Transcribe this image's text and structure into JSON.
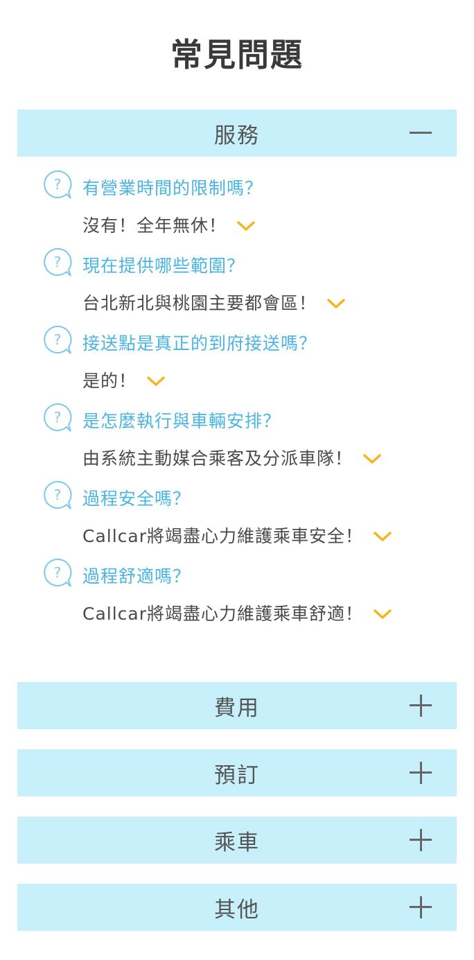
{
  "page": {
    "title": "常見問題"
  },
  "categories": [
    {
      "label": "服務",
      "toggle_icon": "minus-icon",
      "expanded": true,
      "items": [
        {
          "question": "有營業時間的限制嗎？",
          "answer": "沒有！全年無休！"
        },
        {
          "question": "現在提供哪些範圍？",
          "answer": "台北新北與桃園主要都會區！"
        },
        {
          "question": "接送點是真正的到府接送嗎？",
          "answer": "是的！"
        },
        {
          "question": "是怎麼執行與車輛安排？",
          "answer": "由系統主動媒合乘客及分派車隊！"
        },
        {
          "question": "過程安全嗎？",
          "answer": "Callcar將竭盡心力維護乘車安全！"
        },
        {
          "question": "過程舒適嗎？",
          "answer": "Callcar將竭盡心力維護乘車舒適！"
        }
      ]
    },
    {
      "label": "費用",
      "toggle_icon": "plus-icon",
      "expanded": false
    },
    {
      "label": "預訂",
      "toggle_icon": "plus-icon",
      "expanded": false
    },
    {
      "label": "乘車",
      "toggle_icon": "plus-icon",
      "expanded": false
    },
    {
      "label": "其他",
      "toggle_icon": "plus-icon",
      "expanded": false
    }
  ],
  "colors": {
    "category_bg": "#c8f0fb",
    "question_text": "#4ab4e2",
    "answer_text": "#4a4a4a",
    "chevron": "#f5b51e",
    "icon_outline": "#79c9ea"
  }
}
